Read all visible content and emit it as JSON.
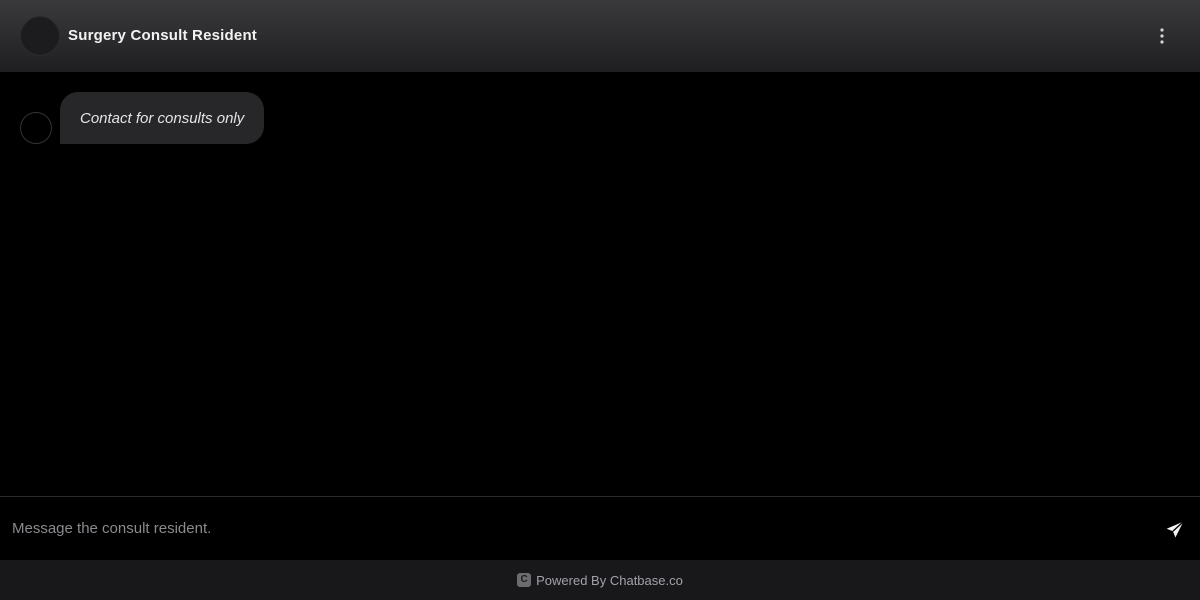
{
  "header": {
    "title": "Surgery Consult Resident",
    "avatar_icon": "bot-avatar",
    "menu_icon": "vertical-ellipsis-icon"
  },
  "messages": [
    {
      "role": "assistant",
      "text": "Contact for consults only"
    }
  ],
  "composer": {
    "placeholder": "Message the consult resident.",
    "value": "",
    "send_icon": "paper-plane-icon"
  },
  "footer": {
    "logo_letter": "C",
    "powered_text": "Powered By Chatbase.co"
  },
  "colors": {
    "header_top": "#3a3a3d",
    "header_bottom": "#1f1f22",
    "bubble": "#27272a",
    "footer_bg": "#18181b",
    "background": "#000000"
  }
}
